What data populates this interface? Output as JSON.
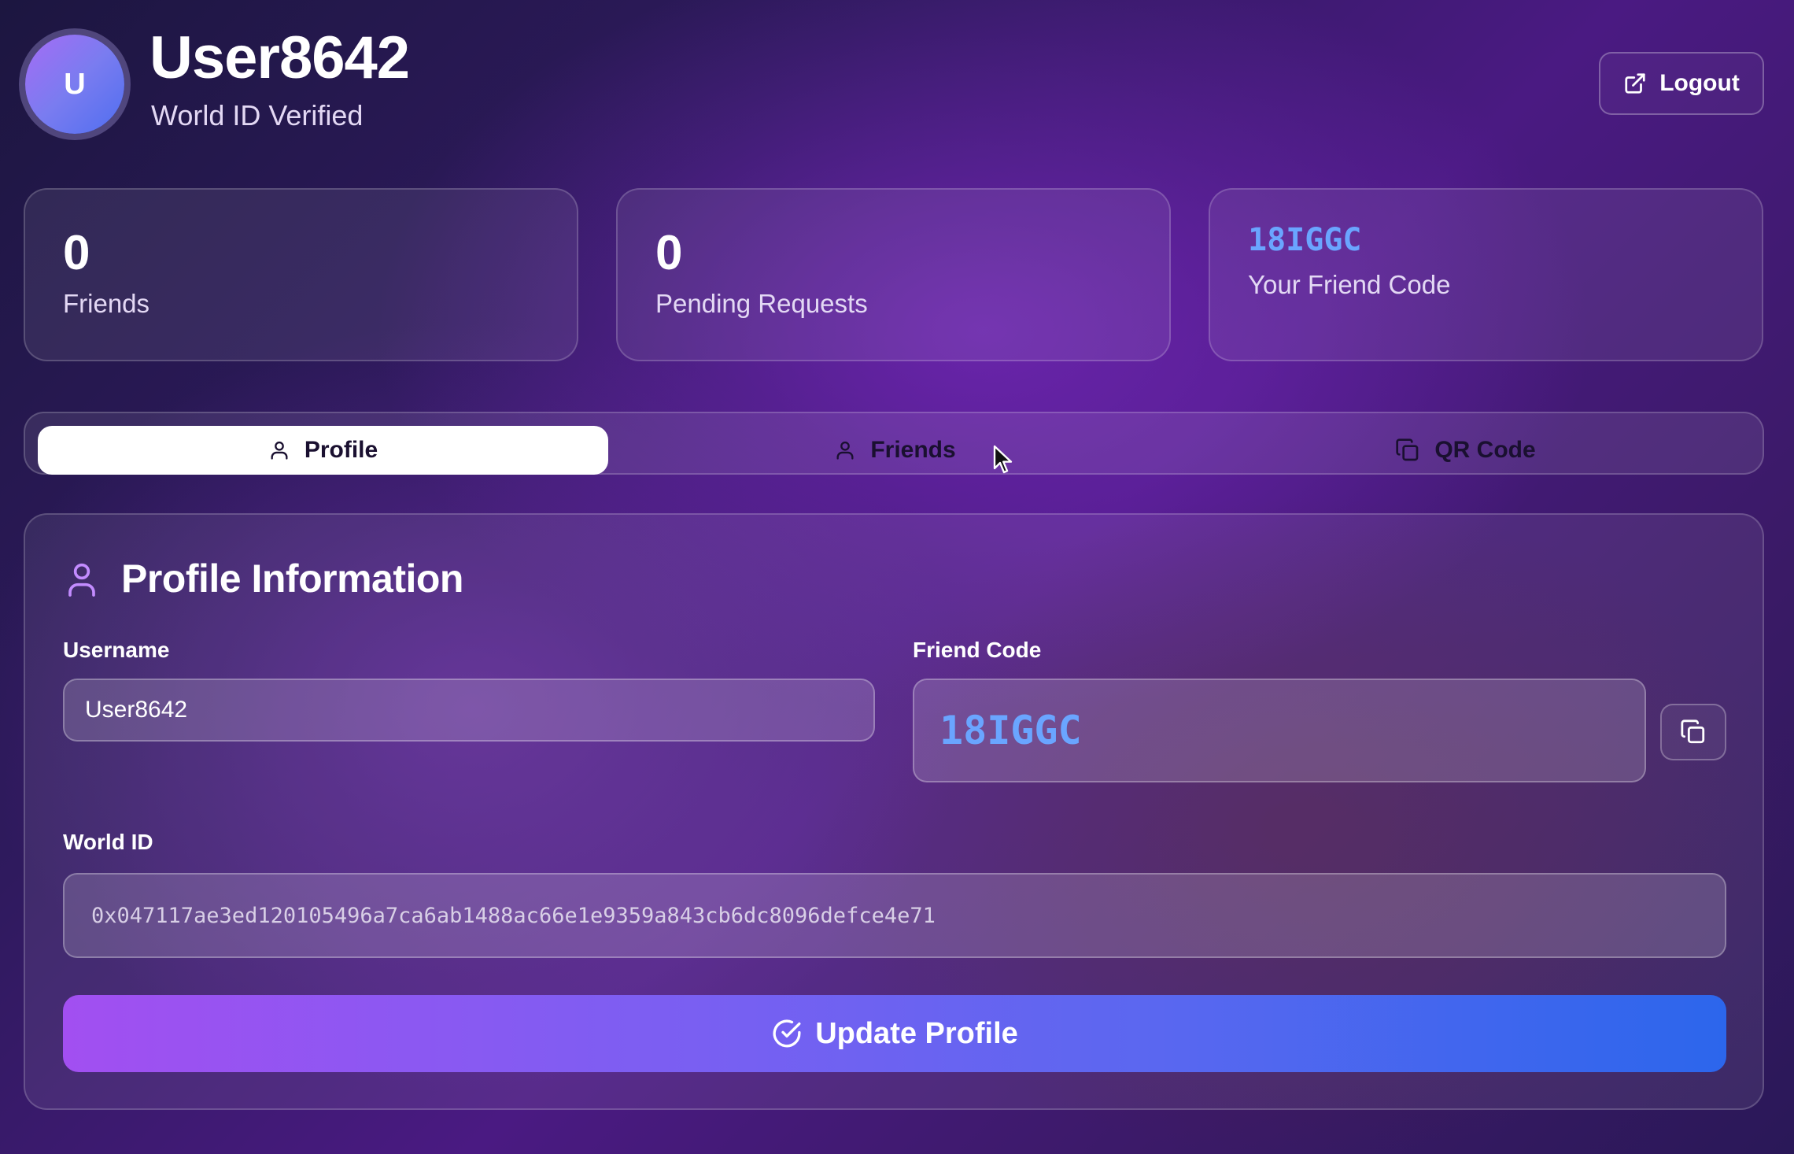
{
  "header": {
    "avatar_initial": "U",
    "username": "User8642",
    "status": "World ID Verified",
    "logout_label": "Logout"
  },
  "stats": {
    "friends_count": "0",
    "friends_label": "Friends",
    "pending_count": "0",
    "pending_label": "Pending Requests",
    "friend_code": "18IGGC",
    "friend_code_label": "Your Friend Code"
  },
  "tabs": [
    {
      "label": "Profile",
      "icon": "user-icon",
      "active": true
    },
    {
      "label": "Friends",
      "icon": "user-icon",
      "active": false
    },
    {
      "label": "QR Code",
      "icon": "copy-icon",
      "active": false
    }
  ],
  "profile": {
    "title": "Profile Information",
    "username_label": "Username",
    "username_value": "User8642",
    "friend_code_label": "Friend Code",
    "friend_code_value": "18IGGC",
    "world_id_label": "World ID",
    "world_id_value": "0x047117ae3ed120105496a7ca6ab1488ac66e1e9359a843cb6dc8096defce4e71",
    "update_label": "Update Profile"
  },
  "colors": {
    "accent_code": "#6aa5ff",
    "button_gradient_start": "#a24ff1",
    "button_gradient_end": "#2c66ec",
    "avatar_gradient_start": "#a56cf5",
    "avatar_gradient_end": "#4f6ef0"
  }
}
